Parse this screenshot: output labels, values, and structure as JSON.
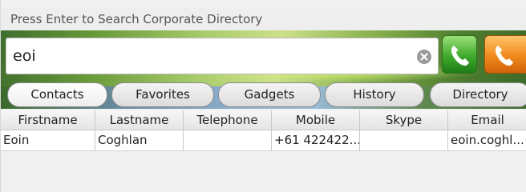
{
  "window": {
    "title": "Press Enter to Search Corporate Directory"
  },
  "search": {
    "value": "eoi",
    "placeholder": ""
  },
  "buttons": {
    "call_icon": "phone-icon",
    "hangup_icon": "phone-icon",
    "clear_icon": "clear-icon"
  },
  "colors": {
    "call_green": "#3ea92c",
    "call_orange": "#f08a1c"
  },
  "tabs": [
    {
      "label": "Contacts",
      "active": true
    },
    {
      "label": "Favorites",
      "active": false
    },
    {
      "label": "Gadgets",
      "active": false
    },
    {
      "label": "History",
      "active": false
    },
    {
      "label": "Directory",
      "active": false
    }
  ],
  "table": {
    "columns": [
      "Firstname",
      "Lastname",
      "Telephone",
      "Mobile",
      "Skype",
      "Email"
    ],
    "rows": [
      [
        "Eoin",
        "Coghlan",
        "",
        "+61 422422...",
        "",
        "eoin.coghl..."
      ]
    ]
  }
}
